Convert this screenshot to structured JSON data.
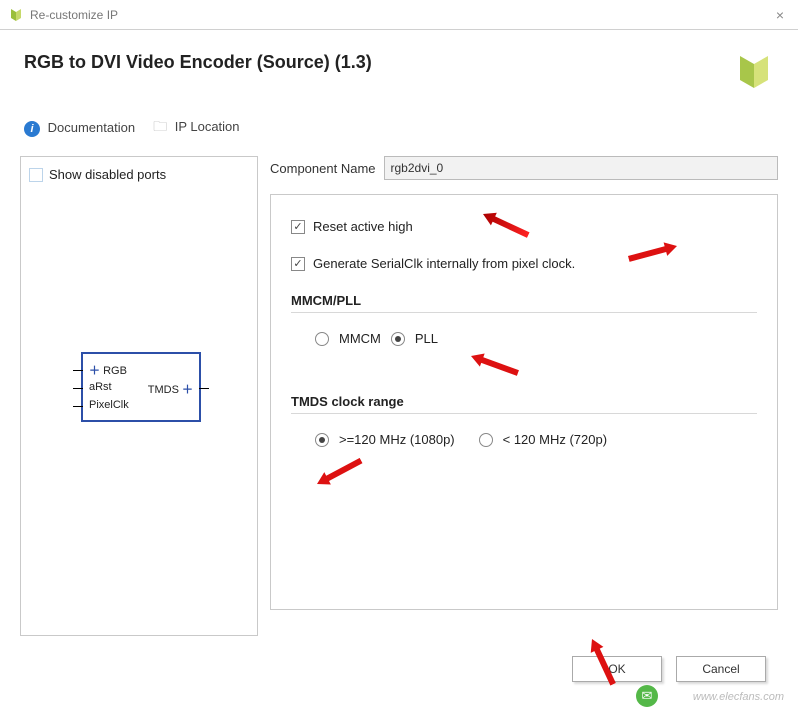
{
  "window": {
    "title": "Re-customize IP",
    "close": "×"
  },
  "header": {
    "title": "RGB to DVI Video Encoder (Source) (1.3)"
  },
  "subnav": {
    "documentation": "Documentation",
    "ip_location": "IP Location"
  },
  "left": {
    "show_disabled": "Show disabled ports",
    "ports": {
      "rgb": "RGB",
      "arst": "aRst",
      "pixelclk": "PixelClk",
      "tmds": "TMDS"
    }
  },
  "right": {
    "comp_name_label": "Component Name",
    "comp_name_value": "rgb2dvi_0",
    "reset_label": "Reset active high",
    "gen_serialclk_label": "Generate SerialClk internally from pixel clock.",
    "mmcm_pll": {
      "section": "MMCM/PLL",
      "mmcm": "MMCM",
      "pll": "PLL"
    },
    "tmds_range": {
      "section": "TMDS clock range",
      "opt1": ">=120 MHz (1080p)",
      "opt2": "< 120 MHz (720p)"
    }
  },
  "footer": {
    "ok": "OK",
    "cancel": "Cancel"
  },
  "watermark": "www.elecfans.com"
}
